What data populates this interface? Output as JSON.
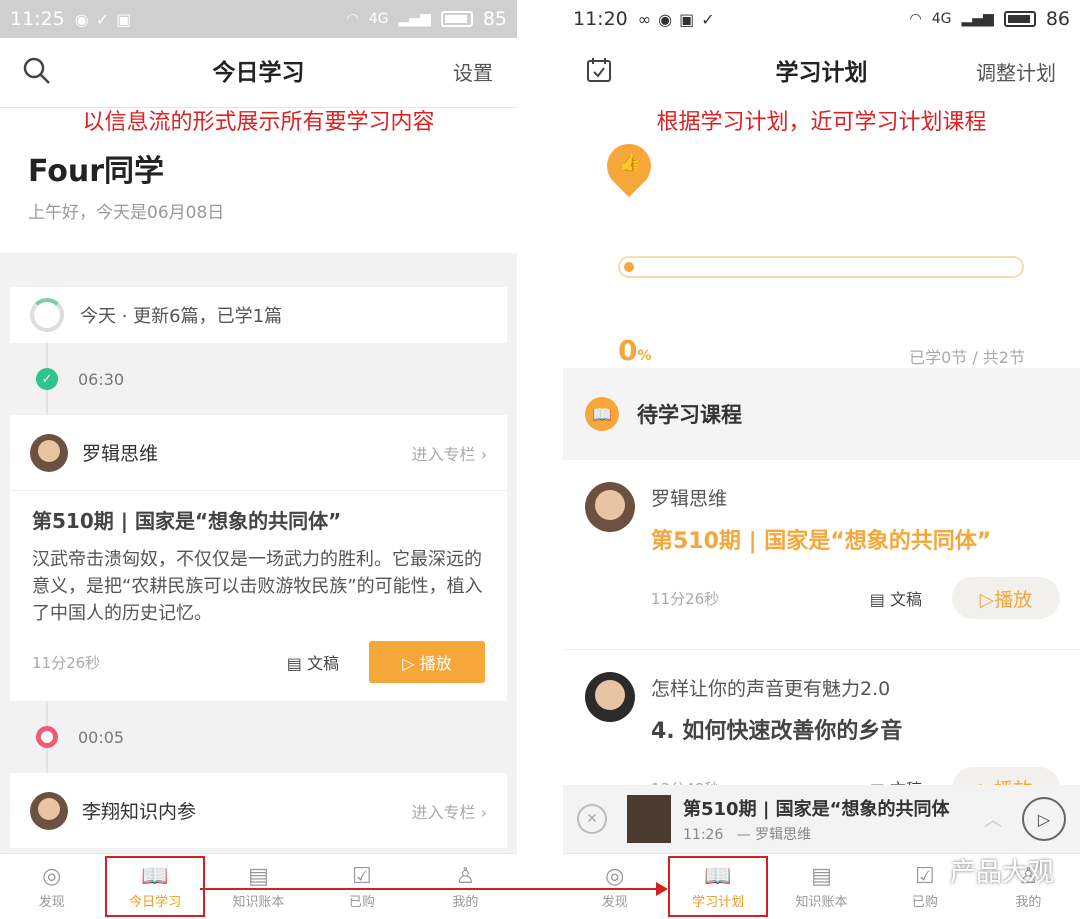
{
  "left": {
    "status": {
      "time": "11:25",
      "battery": "85",
      "net": "4G"
    },
    "nav": {
      "title": "今日学习",
      "settings": "设置"
    },
    "annotation": "以信息流的形式展示所有要学习内容",
    "greeting": {
      "name": "Four同学",
      "sub": "上午好，今天是06月08日"
    },
    "summary": "今天 · 更新6篇，已学1篇",
    "items": [
      {
        "time": "06:30",
        "author": "罗辑思维",
        "enter": "进入专栏",
        "title": "第510期 | 国家是“想象的共同体”",
        "desc": "汉武帝击溃匈奴，不仅仅是一场武力的胜利。它最深远的意义，是把“农耕民族可以击败游牧民族”的可能性，植入了中国人的历史记忆。",
        "duration": "11分26秒",
        "doc": "文稿",
        "play": "播放"
      },
      {
        "time": "00:05",
        "author": "李翔知识内参",
        "enter": "进入专栏"
      }
    ],
    "tabs": [
      "发现",
      "今日学习",
      "知识账本",
      "已购",
      "我的"
    ]
  },
  "right": {
    "status": {
      "time": "11:20",
      "battery": "86",
      "net": "4G"
    },
    "nav": {
      "title": "学习计划",
      "adjust": "调整计划"
    },
    "annotation": "根据学习计划，近可学习计划课程",
    "progress": {
      "percent": "0",
      "unit": "%",
      "learned": "已学0节 / 共2节",
      "fraction": 0
    },
    "section": "待学习课程",
    "courses": [
      {
        "author": "罗辑思维",
        "title": "第510期 | 国家是“想象的共同体”",
        "duration": "11分26秒",
        "doc": "文稿",
        "play": "播放"
      },
      {
        "author": "怎样让你的声音更有魅力2.0",
        "title": "4. 如何快速改善你的乡音",
        "duration": "13分48秒",
        "doc": "文稿",
        "play": "播放"
      }
    ],
    "mini": {
      "title": "第510期 | 国家是“想象的共同体",
      "time": "11:26",
      "source": "— 罗辑思维"
    },
    "tabs": [
      "发现",
      "学习计划",
      "知识账本",
      "已购",
      "我的"
    ]
  },
  "watermark": "产品大观",
  "colors": {
    "accent": "#f6a73a",
    "highlight": "#d42020"
  }
}
